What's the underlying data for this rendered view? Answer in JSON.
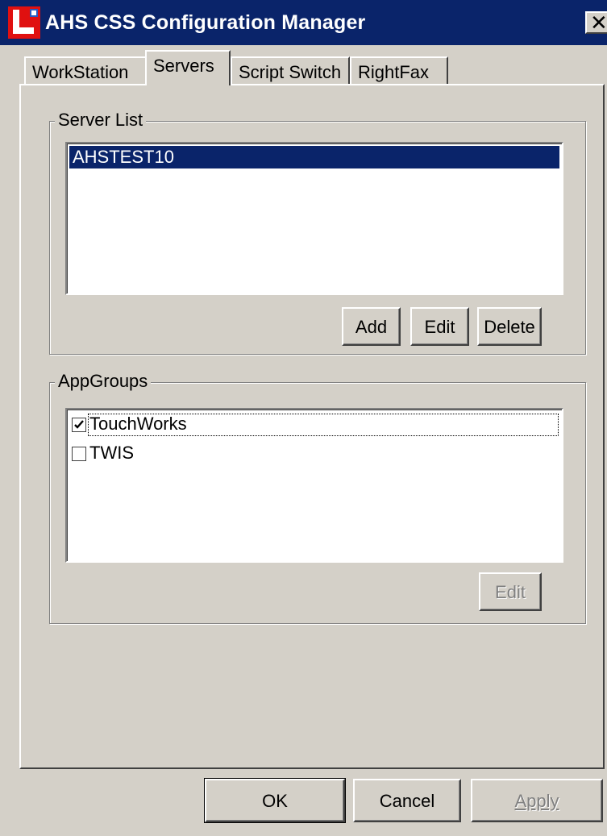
{
  "window": {
    "title": "AHS CSS Configuration Manager",
    "close_glyph": "✕"
  },
  "tabs": [
    {
      "label": "WorkStation",
      "active": false
    },
    {
      "label": "Servers",
      "active": true
    },
    {
      "label": "Script Switch",
      "active": false
    },
    {
      "label": "RightFax",
      "active": false
    }
  ],
  "server_list": {
    "group_label": "Server List",
    "items": [
      "AHSTEST10"
    ],
    "selected_index": 0,
    "buttons": {
      "add": "Add",
      "edit": "Edit",
      "delete": "Delete"
    }
  },
  "app_groups": {
    "group_label": "AppGroups",
    "items": [
      {
        "label": "TouchWorks",
        "checked": true
      },
      {
        "label": "TWIS",
        "checked": false
      }
    ],
    "edit_button": "Edit"
  },
  "footer": {
    "ok": "OK",
    "cancel": "Cancel",
    "apply": "Apply"
  },
  "colors": {
    "face": "#d4d0c8",
    "title_bar": "#0a246a",
    "selection": "#0a246a",
    "disabled_text": "#808080",
    "app_icon": "#e01010"
  }
}
